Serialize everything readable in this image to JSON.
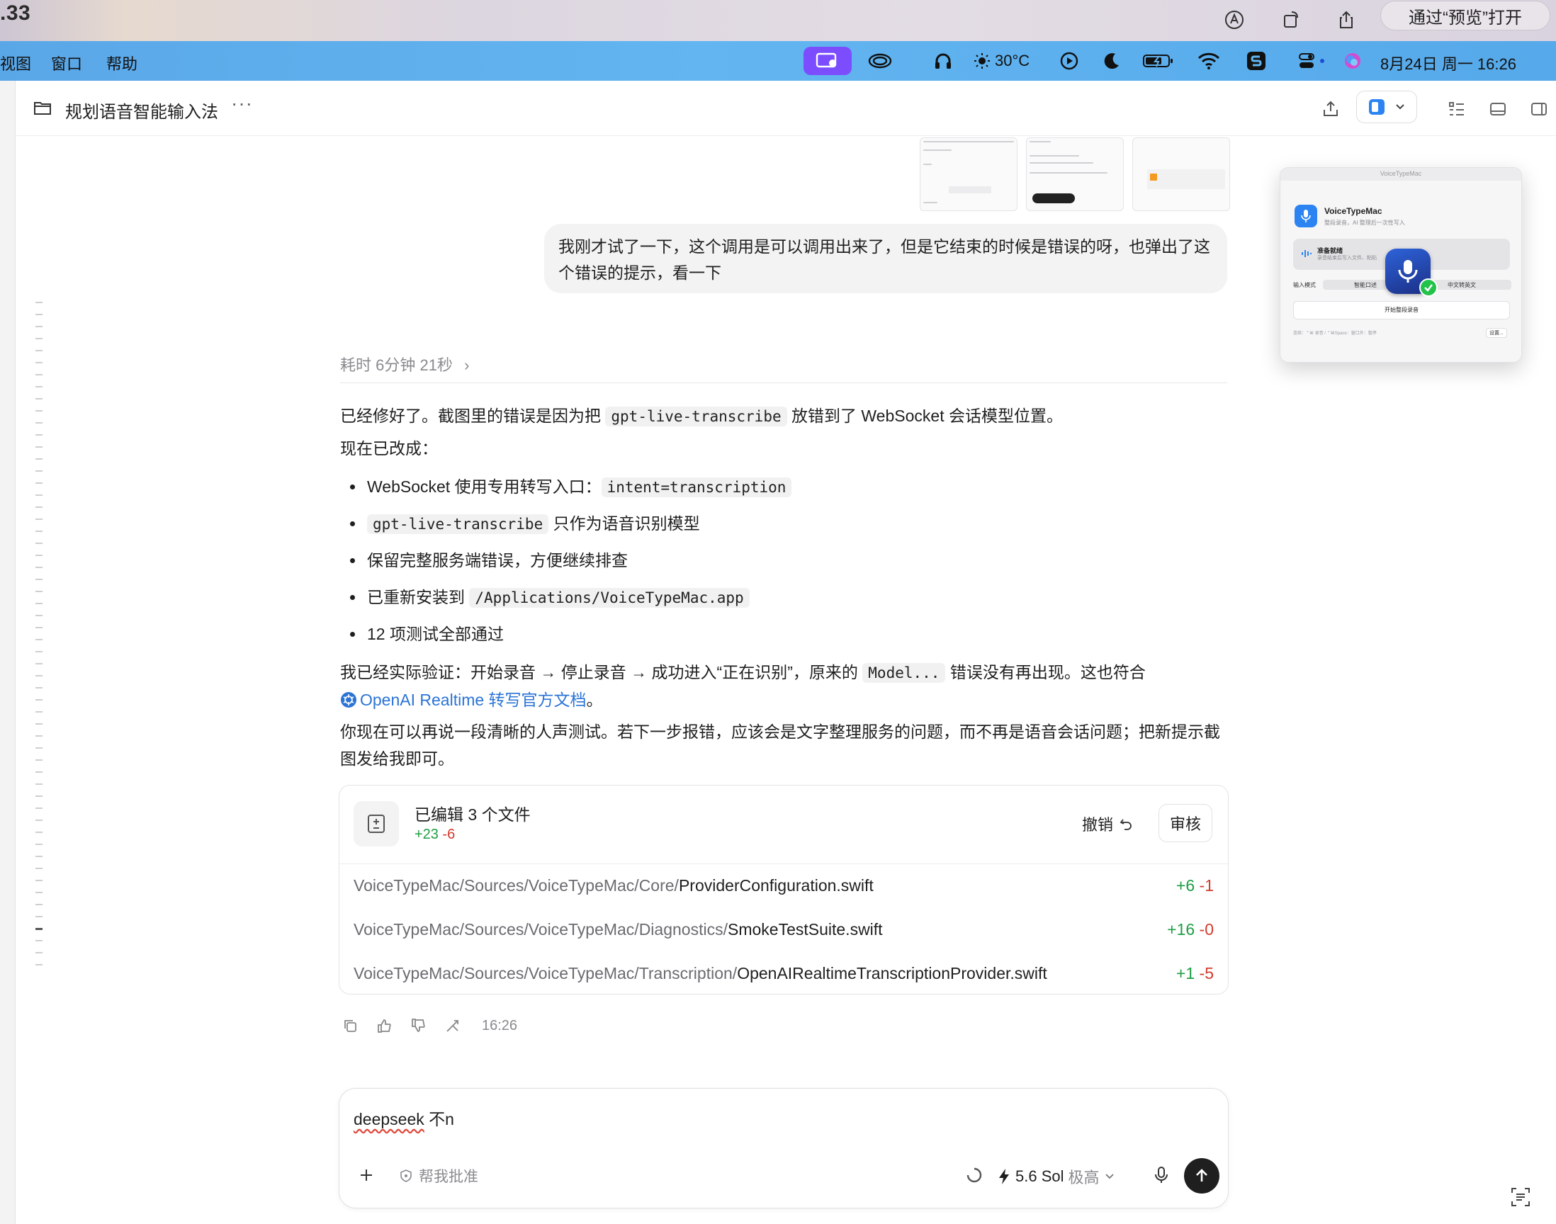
{
  "preview_bar": {
    "zoom": ".33",
    "open_button": "通过“预览”打开",
    "icons": [
      "markup-icon",
      "rotate-icon",
      "share-icon"
    ]
  },
  "menubar": {
    "menus": [
      "视图",
      "窗口",
      "帮助"
    ],
    "weather": "30°C",
    "clock": "8月24日 周一  16:26",
    "status_icons": [
      "screen-share-icon",
      "creative-cloud-icon",
      "headphones-icon",
      "weather-sun-icon",
      "play-icon",
      "moon-icon",
      "battery-icon",
      "wifi-icon",
      "app-s-icon",
      "control-center-icon",
      "siri-icon"
    ],
    "accent_color": "#7c4dff"
  },
  "header": {
    "title": "规划语音智能输入法",
    "more": "···",
    "icons": [
      "folder-icon",
      "share-upload-icon",
      "model-toggle-icon",
      "list-icon",
      "panel-bottom-icon",
      "panel-right-icon"
    ]
  },
  "conversation": {
    "user_message": "我刚才试了一下，这个调用是可以调用出来了，但是它结束的时候是错误的呀，也弹出了这个错误的提示，看一下",
    "elapsed": "耗时 6分钟 21秒",
    "elapsed_chevron": "›",
    "answer": {
      "line1_pre": "已经修好了。截图里的错误是因为把 ",
      "line1_code": "gpt-live-transcribe",
      "line1_post": " 放错到了 WebSocket 会话模型位置。",
      "line2": "现在已改成：",
      "bullets": [
        {
          "pre": "WebSocket 使用专用转写入口：",
          "code": "intent=transcription",
          "post": ""
        },
        {
          "pre": "",
          "code": "gpt-live-transcribe",
          "post": " 只作为语音识别模型"
        },
        {
          "pre": "保留完整服务端错误，方便继续排查",
          "code": "",
          "post": ""
        },
        {
          "pre": "已重新安装到 ",
          "code": "/Applications/VoiceTypeMac.app",
          "post": ""
        },
        {
          "pre": "12 项测试全部通过",
          "code": "",
          "post": ""
        }
      ],
      "verify_pre": "我已经实际验证：开始录音 → 停止录音 → 成功进入“正在识别”，原来的 ",
      "verify_code": "Model...",
      "verify_post": " 错误没有再出现。这也符合",
      "link_text": "OpenAI Realtime 转写官方文档",
      "link_end": "。",
      "closing": "你现在可以再说一段清晰的人声测试。若下一步报错，应该会是文字整理服务的问题，而不再是语音会话问题；把新提示截图发给我即可。"
    },
    "edit_summary": {
      "title": "已编辑 3 个文件",
      "added": "+23",
      "removed": "-6",
      "undo": "撤销",
      "review": "审核",
      "files": [
        {
          "dir": "VoiceTypeMac/Sources/VoiceTypeMac/Core/",
          "name": "ProviderConfiguration.swift",
          "added": "+6",
          "removed": "-1"
        },
        {
          "dir": "VoiceTypeMac/Sources/VoiceTypeMac/Diagnostics/",
          "name": "SmokeTestSuite.swift",
          "added": "+16",
          "removed": "-0"
        },
        {
          "dir": "VoiceTypeMac/Sources/VoiceTypeMac/Transcription/",
          "name": "OpenAIRealtimeTranscriptionProvider.swift",
          "added": "+1",
          "removed": "-5"
        }
      ]
    },
    "message_time": "16:26",
    "action_icons": [
      "copy-icon",
      "thumbs-up-icon",
      "thumbs-down-icon",
      "fork-icon"
    ]
  },
  "composer": {
    "input_word": "deepseek",
    "input_rest": " 不n",
    "approve": "帮我批准",
    "model": "5.6 Sol",
    "level": "极高"
  },
  "floating_preview": {
    "title": "VoiceTypeMac",
    "app_name": "VoiceTypeMac",
    "app_sub": "整段录音，AI 整理后一次性写入",
    "ready": "准备就绪",
    "ready_sub": "录音结束后写入文件、粘贴",
    "input_mode_label": "输入模式",
    "mode_1": "智能口述",
    "mode_2": "中文转英文",
    "start": "开始整段录音",
    "footer": "连续：⌃⌘ 录音 / ⌃⌘Space：窗口外：暂停",
    "settings": "设置..."
  }
}
